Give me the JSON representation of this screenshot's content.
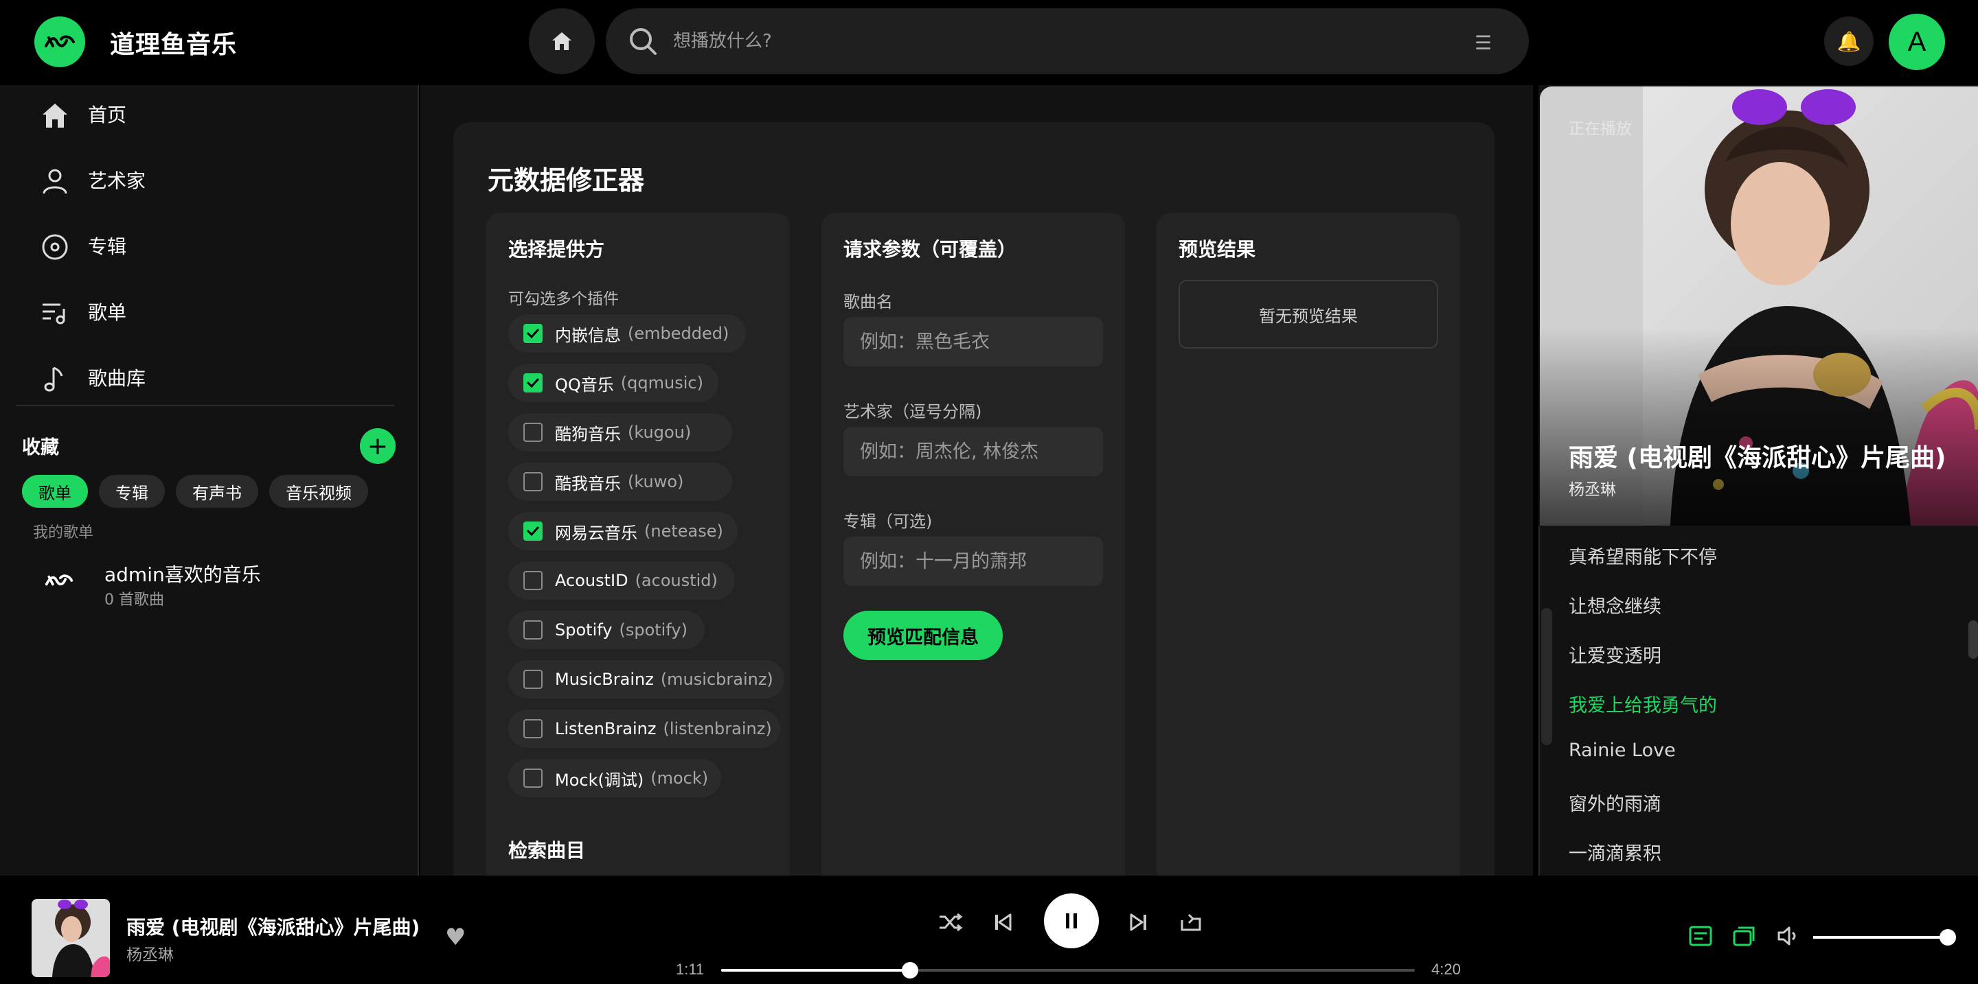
{
  "app": {
    "title": "道理鱼音乐"
  },
  "header": {
    "search_placeholder": "想播放什么?",
    "avatar_letter": "A"
  },
  "sidebar": {
    "items": [
      {
        "label": "首页",
        "icon": "home-icon"
      },
      {
        "label": "艺术家",
        "icon": "person-icon"
      },
      {
        "label": "专辑",
        "icon": "disc-icon"
      },
      {
        "label": "歌单",
        "icon": "playlist-icon"
      },
      {
        "label": "歌曲库",
        "icon": "music-note-icon"
      }
    ],
    "favorites_title": "收藏",
    "chips": [
      "歌单",
      "专辑",
      "有声书",
      "音乐视频"
    ],
    "active_chip": "歌单",
    "my_playlists_label": "我的歌单",
    "playlists": [
      {
        "name": "admin喜欢的音乐",
        "count": "0 首歌曲"
      }
    ]
  },
  "main": {
    "card_title": "元数据修正器",
    "providers": {
      "title": "选择提供方",
      "hint": "可勾选多个插件",
      "options": [
        {
          "name": "内嵌信息",
          "key": "(embedded)",
          "checked": true
        },
        {
          "name": "QQ音乐",
          "key": "(qqmusic)",
          "checked": true
        },
        {
          "name": "酷狗音乐",
          "key": "(kugou)",
          "checked": false
        },
        {
          "name": "酷我音乐",
          "key": "(kuwo)",
          "checked": false
        },
        {
          "name": "网易云音乐",
          "key": "(netease)",
          "checked": true
        },
        {
          "name": "AcoustID",
          "key": "(acoustid)",
          "checked": false
        },
        {
          "name": "Spotify",
          "key": "(spotify)",
          "checked": false
        },
        {
          "name": "MusicBrainz",
          "key": "(musicbrainz)",
          "checked": false
        },
        {
          "name": "ListenBrainz",
          "key": "(listenbrainz)",
          "checked": false
        },
        {
          "name": "Mock(调试)",
          "key": "(mock)",
          "checked": false
        }
      ],
      "search_tracks_title": "检索曲目"
    },
    "params": {
      "title": "请求参数（可覆盖）",
      "song_label": "歌曲名",
      "song_placeholder": "例如：黑色毛衣",
      "artist_label": "艺术家（逗号分隔)",
      "artist_placeholder": "例如：周杰伦, 林俊杰",
      "album_label": "专辑（可选)",
      "album_placeholder": "例如：十一月的萧邦",
      "preview_button": "预览匹配信息"
    },
    "preview": {
      "title": "预览结果",
      "empty": "暂无预览结果"
    }
  },
  "now_playing": {
    "label": "正在播放",
    "title": "雨爱 (电视剧《海派甜心》片尾曲)",
    "artist": "杨丞琳",
    "lyrics": [
      {
        "text": "真希望雨能下不停",
        "active": false
      },
      {
        "text": "让想念继续",
        "active": false
      },
      {
        "text": "让爱变透明",
        "active": false
      },
      {
        "text": "我爱上给我勇气的",
        "active": true
      },
      {
        "text": "Rainie Love",
        "active": false
      },
      {
        "text": "窗外的雨滴",
        "active": false
      },
      {
        "text": "一滴滴累积",
        "active": false
      }
    ]
  },
  "player": {
    "title": "雨爱 (电视剧《海派甜心》片尾曲)",
    "artist": "杨丞琳",
    "current_time": "1:11",
    "total_time": "4:20",
    "progress": 0.272,
    "volume": 1.0
  },
  "colors": {
    "accent": "#1ed760",
    "background": "#000000",
    "panel": "#121212",
    "card": "#1c1c1c"
  }
}
